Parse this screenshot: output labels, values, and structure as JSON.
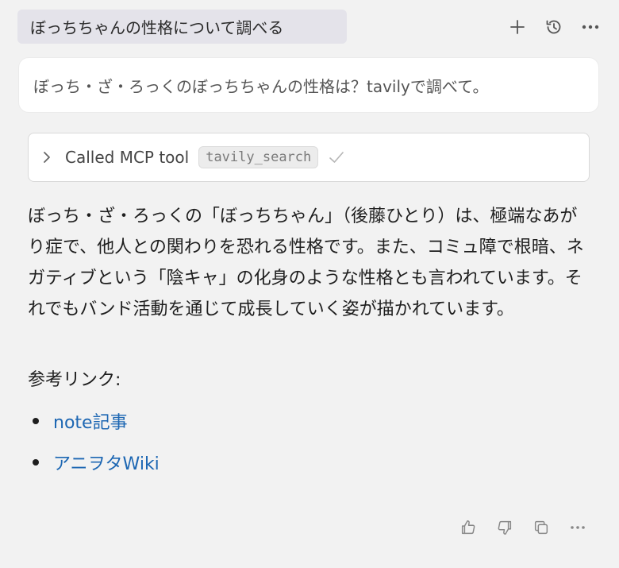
{
  "header": {
    "title": "ぼっちちゃんの性格について調べる",
    "actions": [
      {
        "icon": "plus-icon"
      },
      {
        "icon": "history-icon"
      },
      {
        "icon": "more-icon"
      }
    ]
  },
  "user_message": {
    "text": "ぼっち・ざ・ろっくのぼっちちゃんの性格は？tavilyで調べて。"
  },
  "tool_call": {
    "label": "Called MCP tool",
    "tool_name": "tavily_search",
    "status_icon": "check-icon"
  },
  "response": {
    "paragraph": "ぼっち・ざ・ろっくの「ぼっちちゃん」（後藤ひとり）は、極端なあがり症で、他人との関わりを恐れる性格です。また、コミュ障で根暗、ネガティブという「陰キャ」の化身のような性格とも言われています。それでもバンド活動を通じて成長していく姿が描かれています。",
    "references_label": "参考リンク:",
    "links": [
      {
        "label": "note記事"
      },
      {
        "label": "アニヲタWiki"
      }
    ]
  },
  "footer": {
    "actions": [
      {
        "icon": "thumbs-up-icon"
      },
      {
        "icon": "thumbs-down-icon"
      },
      {
        "icon": "copy-icon"
      },
      {
        "icon": "more-icon"
      }
    ]
  },
  "colors": {
    "background": "#f2f2f2",
    "title_pill": "#e4e3ea",
    "link": "#1d67b3"
  }
}
